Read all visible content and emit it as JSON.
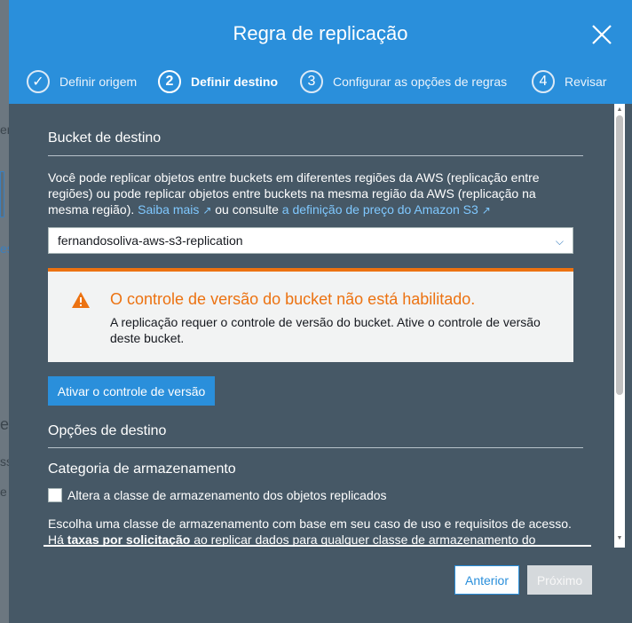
{
  "modal": {
    "title": "Regra de replicação",
    "close_icon": "close-icon"
  },
  "steps": [
    {
      "marker": "✓",
      "label": "Definir origem",
      "state": "done"
    },
    {
      "marker": "2",
      "label": "Definir destino",
      "state": "active"
    },
    {
      "marker": "3",
      "label": "Configurar as opções de regras",
      "state": "pending"
    },
    {
      "marker": "4",
      "label": "Revisar",
      "state": "pending"
    }
  ],
  "destination": {
    "section_title": "Bucket de destino",
    "description_1": "Você pode replicar objetos entre buckets em diferentes regiões da AWS (replicação entre regiões) ou pode replicar objetos entre buckets na mesma região da AWS (replicação na mesma região). ",
    "learn_more_link": "Saiba mais",
    "description_2": " ou consulte ",
    "pricing_link": "a definição de preço do Amazon S3",
    "bucket_select": "fernandosoliva-aws-s3-replication"
  },
  "alert": {
    "title": "O controle de versão do bucket não está habilitado.",
    "text": "A replicação requer o controle de versão do bucket. Ative o controle de versão deste bucket."
  },
  "enable_versioning_button": "Ativar o controle de versão",
  "destination_options": {
    "section_title": "Opções de destino",
    "storage_title": "Categoria de armazenamento",
    "checkbox_label": "Altera a classe de armazenamento dos objetos replicados",
    "text_1": "Escolha uma classe de armazenamento com base em seu caso de uso e requisitos de acesso.",
    "text_2a": "Há ",
    "text_2b": "taxas por solicitação",
    "text_2c": " ao replicar dados para qualquer classe de armazenamento do"
  },
  "footer": {
    "previous": "Anterior",
    "next": "Próximo"
  },
  "background_fragments": [
    "en",
    "es",
    "e",
    "ss",
    "e"
  ],
  "colors": {
    "header": "#2a8fdb",
    "modal_body": "#465866",
    "alert_accent": "#ec7211",
    "link": "#7fc8ff"
  }
}
